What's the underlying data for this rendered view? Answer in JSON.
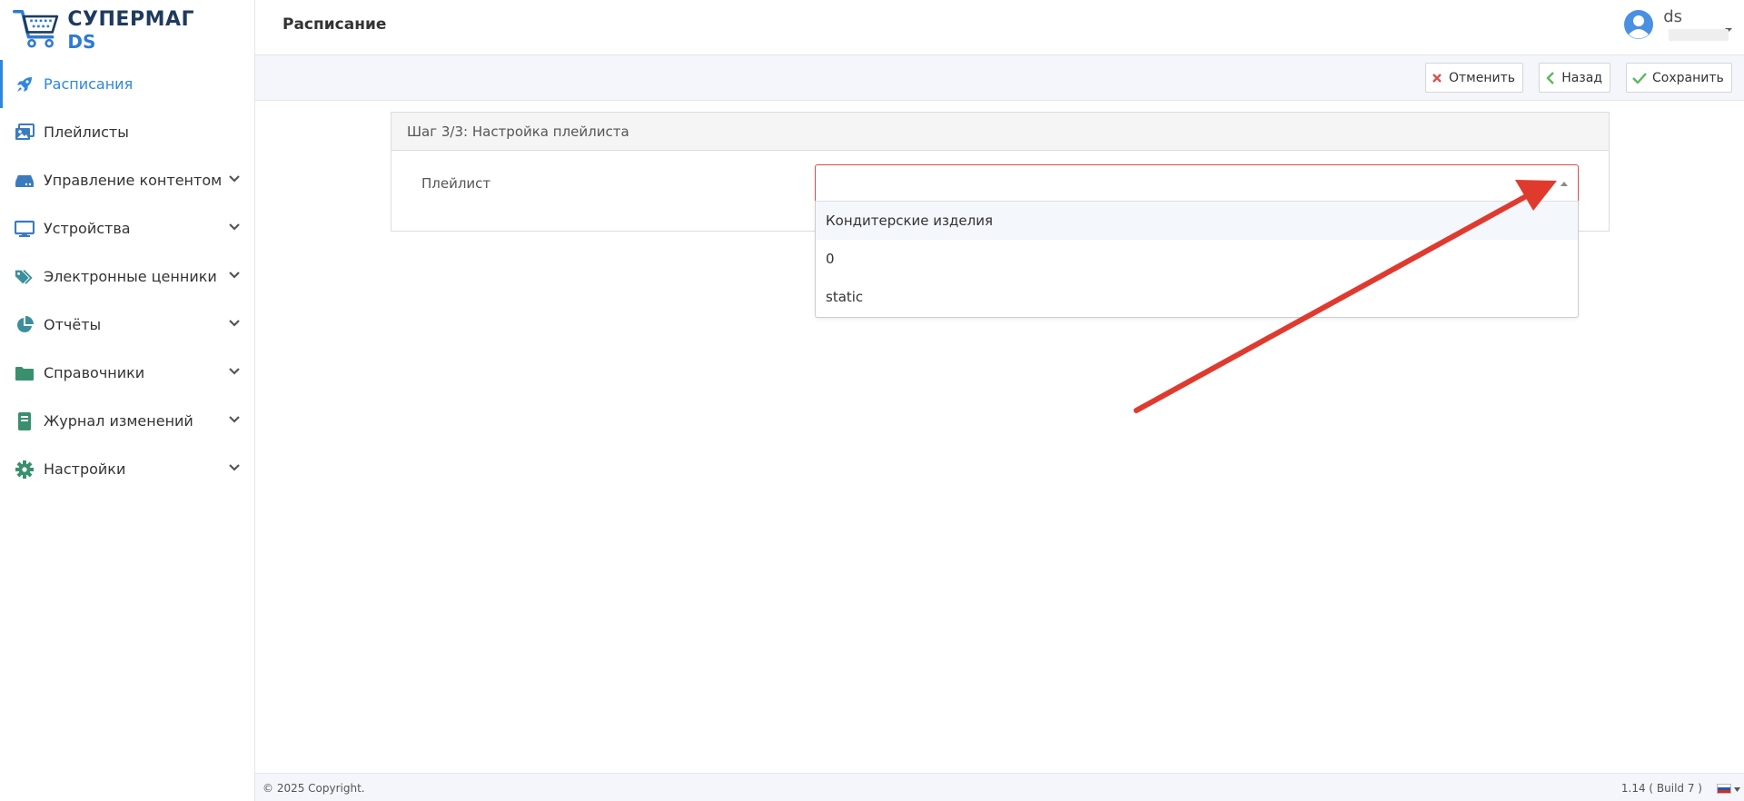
{
  "brand": {
    "line1": "СУПЕРМАГ",
    "line2": "DS"
  },
  "header": {
    "title": "Расписание",
    "username": "ds"
  },
  "sidebar": {
    "items": [
      {
        "label": "Расписания",
        "icon": "rocket-icon",
        "active": true
      },
      {
        "label": "Плейлисты",
        "icon": "images-icon"
      },
      {
        "label": "Управление контентом",
        "icon": "hdd-icon",
        "expandable": true
      },
      {
        "label": "Устройства",
        "icon": "monitor-icon",
        "expandable": true
      },
      {
        "label": "Электронные ценники",
        "icon": "tags-icon",
        "expandable": true
      },
      {
        "label": "Отчёты",
        "icon": "pie-chart-icon",
        "expandable": true
      },
      {
        "label": "Справочники",
        "icon": "folder-icon",
        "expandable": true
      },
      {
        "label": "Журнал изменений",
        "icon": "book-icon",
        "expandable": true
      },
      {
        "label": "Настройки",
        "icon": "gear-icon",
        "expandable": true
      }
    ]
  },
  "toolbar": {
    "cancel_label": "Отменить",
    "back_label": "Назад",
    "save_label": "Сохранить"
  },
  "panel": {
    "title": "Шаг 3/3: Настройка плейлиста",
    "field_label": "Плейлист"
  },
  "playlist_select": {
    "value": "",
    "options": [
      "Кондитерские изделия",
      "0",
      "static"
    ],
    "highlighted_index": 0
  },
  "footer": {
    "copyright": "© 2025 Copyright.",
    "version": "1.14 ( Build 7 )"
  },
  "colors": {
    "accent": "#2e86de",
    "error_border": "#e04848",
    "annotation_arrow": "#e03a2f",
    "icon_teal": "#3a8f9a",
    "cancel_red": "#d9534f",
    "ok_green": "#5cb85c"
  }
}
